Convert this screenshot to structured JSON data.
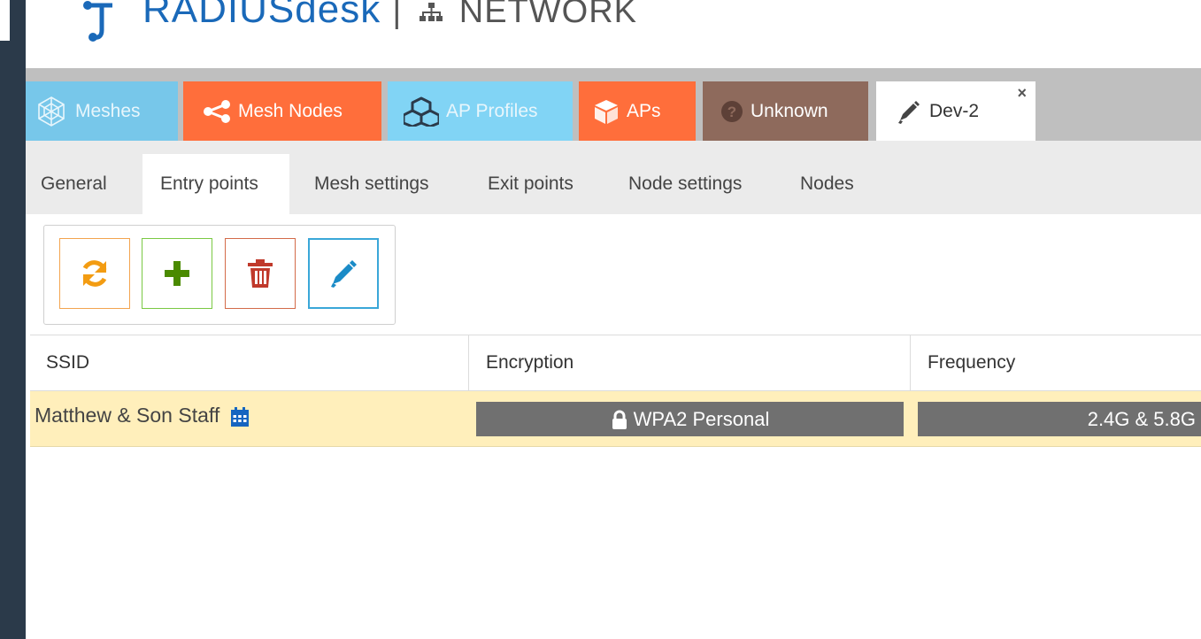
{
  "header": {
    "app_name": "RADIUSdesk",
    "separator": "|",
    "section": "NETWORK",
    "brand_color": "#1a69b9"
  },
  "main_tabs": [
    {
      "label": "Meshes",
      "icon": "mesh-network-icon",
      "color": "#77c7ea"
    },
    {
      "label": "Mesh Nodes",
      "icon": "share-nodes-icon",
      "color": "#ff6e3b"
    },
    {
      "label": "AP Profiles",
      "icon": "cubes-icon",
      "color": "#81d4f5"
    },
    {
      "label": "APs",
      "icon": "cube-icon",
      "color": "#ff6e3b"
    },
    {
      "label": "Unknown",
      "icon": "question-circle-icon",
      "color": "#8e6a5c"
    },
    {
      "label": "Dev-2",
      "icon": "pencil-icon",
      "active": true,
      "closable": true,
      "close_label": "×"
    }
  ],
  "sub_tabs": [
    {
      "label": "General"
    },
    {
      "label": "Entry points",
      "active": true
    },
    {
      "label": "Mesh settings"
    },
    {
      "label": "Exit points"
    },
    {
      "label": "Node settings"
    },
    {
      "label": "Nodes"
    }
  ],
  "toolbar": {
    "buttons": [
      {
        "name": "reload",
        "icon": "refresh-icon",
        "color": "#f39c12"
      },
      {
        "name": "add",
        "icon": "plus-icon",
        "color": "#4a8a00"
      },
      {
        "name": "delete",
        "icon": "trash-icon",
        "color": "#c0392b"
      },
      {
        "name": "edit",
        "icon": "pencil-icon",
        "color": "#1a8bc7"
      }
    ]
  },
  "grid": {
    "columns": [
      "SSID",
      "Encryption",
      "Frequency"
    ],
    "rows": [
      {
        "ssid": "Matthew & Son Staff",
        "ssid_icon": "calendar-icon",
        "encryption": "WPA2 Personal",
        "encryption_icon": "lock-icon",
        "frequency": "2.4G & 5.8G"
      }
    ]
  }
}
